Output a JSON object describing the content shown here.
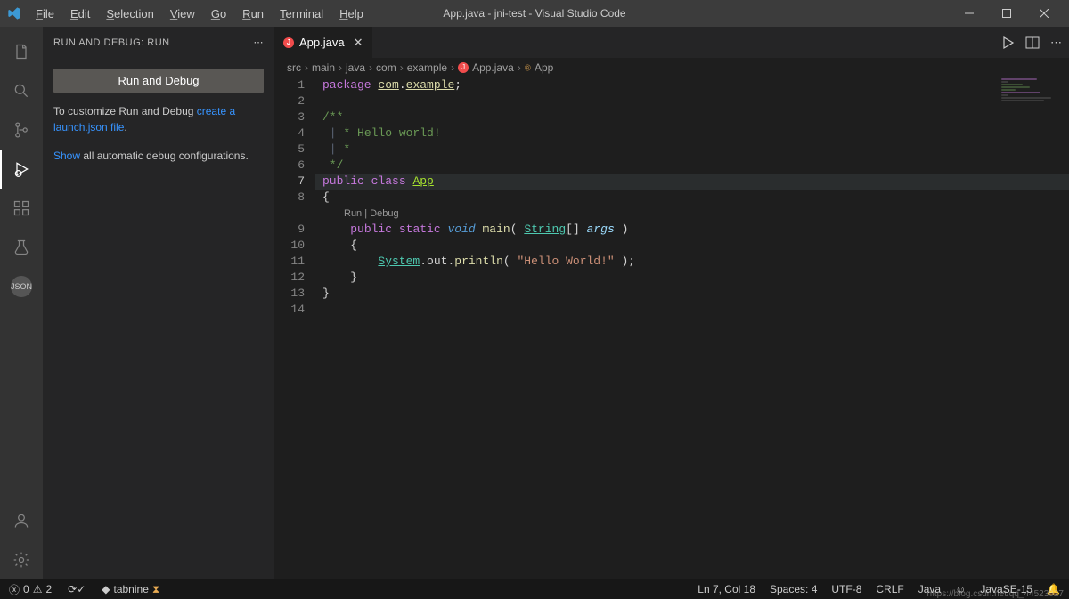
{
  "window": {
    "title": "App.java - jni-test - Visual Studio Code"
  },
  "menu": {
    "file": "File",
    "edit": "Edit",
    "selection": "Selection",
    "view": "View",
    "go": "Go",
    "run": "Run",
    "terminal": "Terminal",
    "help": "Help"
  },
  "sidebar": {
    "header": "RUN AND DEBUG: RUN",
    "button": "Run and Debug",
    "customize_pre": "To customize Run and Debug ",
    "customize_link": "create a launch.json file",
    "customize_post": ".",
    "show_link": "Show",
    "show_post": " all automatic debug configurations."
  },
  "tab": {
    "name": "App.java"
  },
  "breadcrumbs": [
    "src",
    "main",
    "java",
    "com",
    "example",
    "App.java",
    "App"
  ],
  "codelens": {
    "run": "Run",
    "debug": "Debug"
  },
  "code": {
    "l1_kw": "package",
    "l1_pkg1": "com",
    "l1_pkg2": "example",
    "l3": "/**",
    "l4": " * Hello world!",
    "l5": " *",
    "l6": " */",
    "l7_kw1": "public",
    "l7_kw2": "class",
    "l7_cls": "App",
    "l8": "{",
    "l9_kw1": "public",
    "l9_kw2": "static",
    "l9_type": "void",
    "l9_fn": "main",
    "l9_argtype": "String",
    "l9_arg": "args",
    "l10": "    {",
    "l11_cls": "System",
    "l11_m1": "out",
    "l11_m2": "println",
    "l11_str": "\"Hello World!\"",
    "l12": "    }",
    "l13": "}"
  },
  "status": {
    "errors": "0",
    "warnings": "2",
    "tabnine": "tabnine",
    "ln_col": "Ln 7, Col 18",
    "spaces": "Spaces: 4",
    "encoding": "UTF-8",
    "eol": "CRLF",
    "lang": "Java",
    "jdk": "JavaSE-15"
  },
  "watermark": "https://blog.csdn.net/qq_44523027"
}
